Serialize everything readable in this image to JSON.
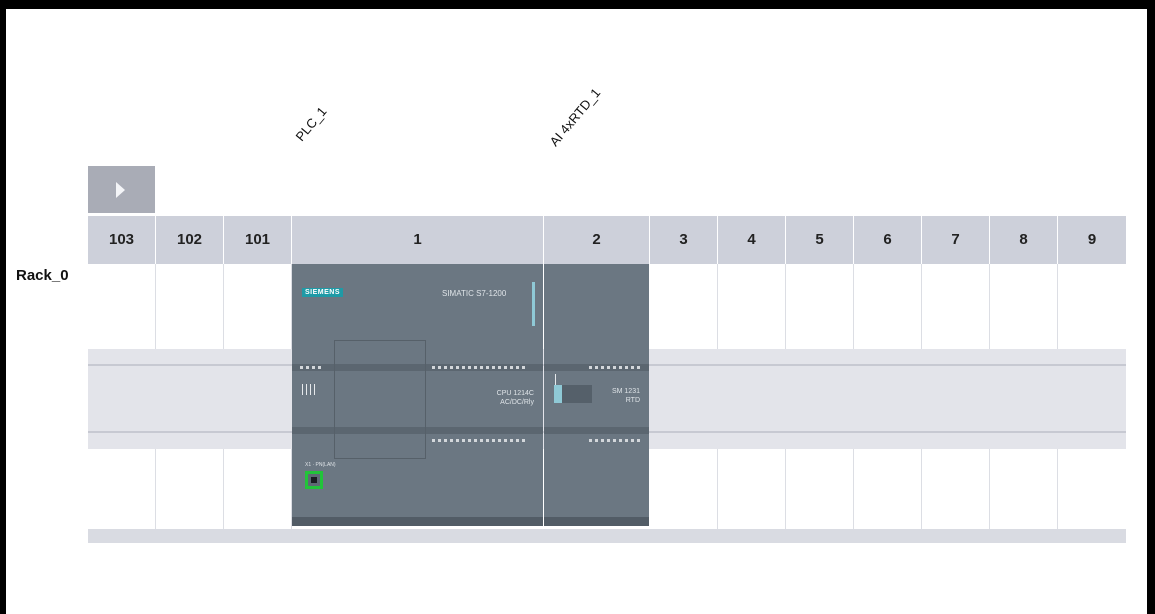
{
  "modules": [
    {
      "label": "PLC_1"
    },
    {
      "label": "AI 4xRTD_1"
    }
  ],
  "slots": [
    "103",
    "102",
    "101",
    "1",
    "2",
    "3",
    "4",
    "5",
    "6",
    "7",
    "8",
    "9"
  ],
  "rack": {
    "label": "Rack_0"
  },
  "cpu": {
    "brand": "SIEMENS",
    "family": "SIMATIC S7-1200",
    "model": "CPU 1214C",
    "variant": "AC/DC/Rly",
    "port_label": "X1 · PN(LAN)"
  },
  "sm": {
    "model": "SM 1231",
    "variant": "RTD"
  },
  "colors": {
    "module_body": "#6b7782",
    "header_bg": "#cdd0da",
    "rail": "#e3e4ea",
    "port_highlight": "#22c43a",
    "expand_button": "#a9acb6"
  },
  "icons": {
    "expand": "triangle-right-icon",
    "port": "ethernet-port-icon"
  }
}
